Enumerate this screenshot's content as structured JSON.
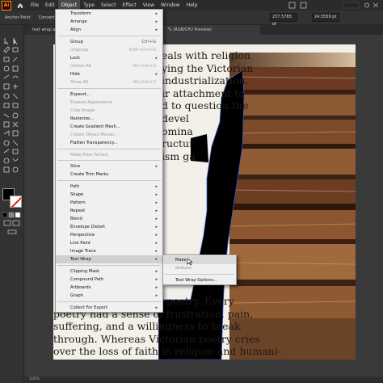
{
  "menubar": {
    "logo": "Ai",
    "items": [
      "File",
      "Edit",
      "Object",
      "Type",
      "Select",
      "Effect",
      "View",
      "Window",
      "Help"
    ]
  },
  "controlbar": {
    "anchor_label": "Anchor Point",
    "convert_label": "Convert:",
    "x_value": "237.5783 pt",
    "y_value": "24.5559 pt"
  },
  "tabbar": {
    "doc_tab": "text wrap.ai*",
    "active_tab": "% (RGB/CPU Preview)"
  },
  "object_menu": {
    "items": [
      {
        "label": "Transform",
        "submenu": true
      },
      {
        "label": "Arrange",
        "submenu": true
      },
      {
        "label": "Align",
        "submenu": true
      },
      {
        "label": "Group",
        "shortcut": "Ctrl+G"
      },
      {
        "label": "Ungroup",
        "shortcut": "Shift+Ctrl+G",
        "disabled": true
      },
      {
        "label": "Lock",
        "submenu": true
      },
      {
        "label": "Unlock All",
        "shortcut": "Alt+Ctrl+2",
        "disabled": true
      },
      {
        "label": "Hide",
        "submenu": true
      },
      {
        "label": "Show All",
        "shortcut": "Alt+Ctrl+3",
        "disabled": true
      },
      {
        "label": "Expand..."
      },
      {
        "label": "Expand Appearance",
        "disabled": true
      },
      {
        "label": "Crop Image",
        "disabled": true
      },
      {
        "label": "Rasterize..."
      },
      {
        "label": "Create Gradient Mesh..."
      },
      {
        "label": "Create Object Mosaic...",
        "disabled": true
      },
      {
        "label": "Flatten Transparency..."
      },
      {
        "label": "Make Pixel Perfect",
        "disabled": true
      },
      {
        "label": "Slice",
        "submenu": true
      },
      {
        "label": "Create Trim Marks"
      },
      {
        "label": "Path",
        "submenu": true
      },
      {
        "label": "Shape",
        "submenu": true
      },
      {
        "label": "Pattern",
        "submenu": true
      },
      {
        "label": "Repeat",
        "submenu": true
      },
      {
        "label": "Blend",
        "submenu": true
      },
      {
        "label": "Envelope Distort",
        "submenu": true
      },
      {
        "label": "Perspective",
        "submenu": true
      },
      {
        "label": "Live Paint",
        "submenu": true
      },
      {
        "label": "Image Trace",
        "submenu": true
      },
      {
        "label": "Text Wrap",
        "submenu": true,
        "highlight": true
      },
      {
        "label": "Clipping Mask",
        "submenu": true
      },
      {
        "label": "Compound Path",
        "submenu": true
      },
      {
        "label": "Artboards",
        "submenu": true
      },
      {
        "label": "Graph",
        "submenu": true
      },
      {
        "label": "Collect For Export",
        "submenu": true
      }
    ]
  },
  "text_wrap_submenu": {
    "items": [
      {
        "label": "Make"
      },
      {
        "label": "Release",
        "disabled": true
      },
      {
        "label": "Text Wrap Options..."
      }
    ]
  },
  "poem": {
    "top_lines": [
      "eals with religion",
      "ying the Victorian",
      "industrialization.",
      "ir attachment to",
      "d to question the",
      "devel",
      "omina",
      "ructur",
      "ism ga"
    ],
    "bottom_lines": [
      "poetry. Every ",
      "poetry had a sense of frustration, pain,",
      "suffering, and a willingness to break",
      "through. Whereas Victorian poetry cries",
      "over the loss of faith in religion and humani-"
    ]
  },
  "statusbar": {
    "zoom": "100%"
  }
}
